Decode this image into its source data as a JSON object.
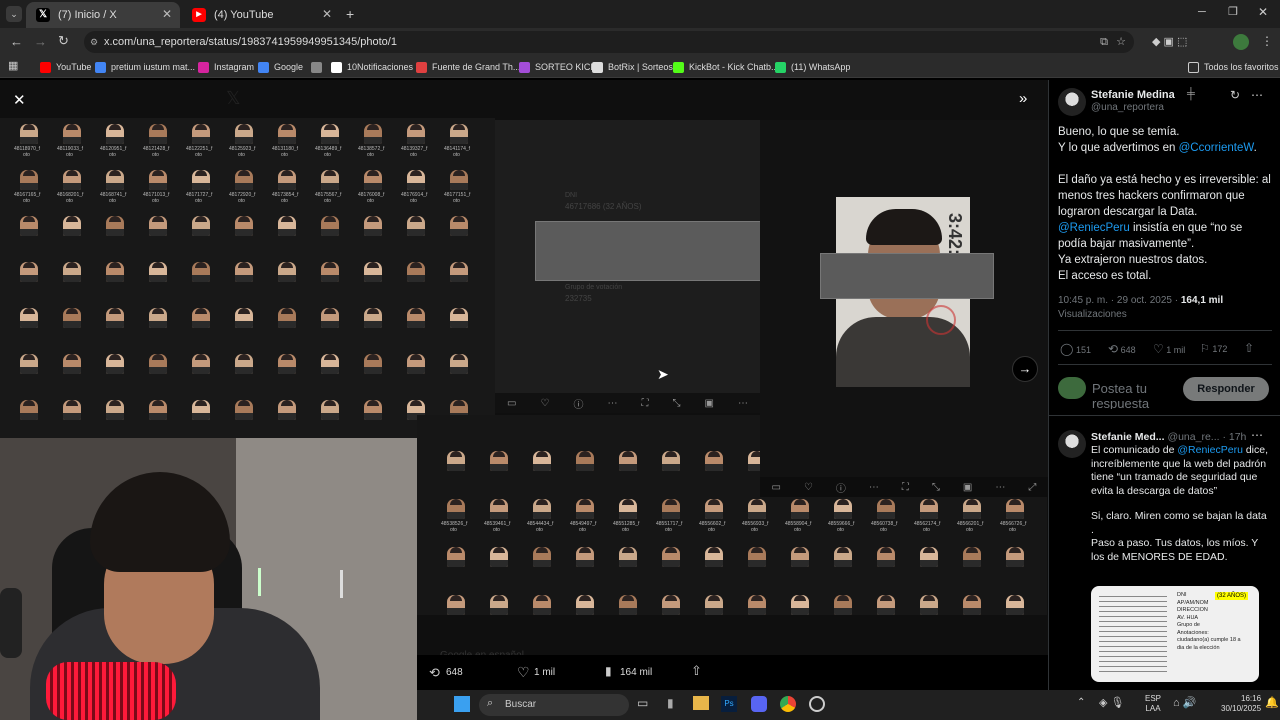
{
  "browser": {
    "tabs": [
      {
        "label": "(7) Inicio / X",
        "icon": "x-logo-icon"
      },
      {
        "label": "(4) YouTube",
        "icon": "youtube-icon"
      }
    ],
    "url": "x.com/una_reportera/status/1983741959949951345/photo/1",
    "bookmarks": [
      {
        "label": "YouTube",
        "color": "#ff0000"
      },
      {
        "label": "pretium iustum mat...",
        "color": "#4285f4"
      },
      {
        "label": "Instagram",
        "color": "#d6249f"
      },
      {
        "label": "Google",
        "color": "#4285f4"
      },
      {
        "label": "",
        "color": "#888888"
      },
      {
        "label": "10Notificaciones",
        "color": "#ffffff"
      },
      {
        "label": "Fuente de Grand Th...",
        "color": "#e04040"
      },
      {
        "label": "SORTEO KICK",
        "color": "#a34dd8"
      },
      {
        "label": "BotRix | Sorteos",
        "color": "#dddddd"
      },
      {
        "label": "KickBot - Kick Chatb...",
        "color": "#53fc18"
      },
      {
        "label": "(11) WhatsApp",
        "color": "#25d366"
      }
    ],
    "all_bookmarks": "Todos los favoritos"
  },
  "viewer": {
    "doc_snippets": {
      "dni_label": "DNI",
      "dni_value": "46717686 (32 AÑOS)",
      "group_label": "Grupo de votación",
      "group_value": "232735"
    },
    "stamp": "3:42:3",
    "sheet_caption": "oto",
    "ids_top": [
      "48118970_f",
      "48119033_f",
      "48120951_f",
      "48121428_f",
      "48122251_f",
      "48125923_f",
      "48131180_f",
      "48136489_f",
      "48138572_f",
      "48139327_f",
      "48141174_f"
    ],
    "ids_row2": [
      "48167165_f",
      "48168201_f",
      "48168741_f",
      "48171013_f",
      "48171727_f",
      "48172920_f",
      "48173854_f",
      "48175567_f",
      "48176008_f",
      "48176914_f",
      "48177151_f"
    ],
    "ids_bottom": [
      "48538526_f",
      "48539461_f",
      "48544434_f",
      "48549497_f",
      "48551285_f",
      "48551717_f",
      "48556602_f",
      "48556933_f",
      "48558904_f",
      "48559666_f",
      "48560738_f",
      "48562174_f",
      "48566201_f",
      "48566726_f"
    ],
    "stats": {
      "retweets": "648",
      "likes": "1 mil",
      "views": "164 mil"
    },
    "behind_text": "Google en español"
  },
  "post": {
    "author_name": "Stefanie Medina",
    "handle": "@una_reportera",
    "lines": [
      {
        "pre": "Bueno, lo que se temía.",
        "link": "",
        "post": ""
      },
      {
        "pre": "Y lo que advertimos en ",
        "link": "@CcorrienteW",
        "post": "."
      },
      {
        "pre": "",
        "link": "",
        "post": ""
      },
      {
        "pre": "El daño ya está hecho y es irreversible: al menos tres hackers confirmaron que lograron descargar la Data.",
        "link": "",
        "post": ""
      },
      {
        "pre": "",
        "link": "@ReniecPeru",
        "post": " insistía en que “no se podía bajar masivamente”."
      },
      {
        "pre": "Ya extrajeron nuestros datos.",
        "link": "",
        "post": ""
      },
      {
        "pre": "El acceso es total.",
        "link": "",
        "post": ""
      }
    ],
    "time": "10:45 p. m. · 29 oct. 2025",
    "views_count": "164,1 mil",
    "views_label": "Visualizaciones",
    "actions": {
      "replies": "151",
      "retweets": "648",
      "likes": "1 mil",
      "bookmarks": "172"
    },
    "reply_placeholder": "Postea tu respuesta",
    "reply_button": "Responder"
  },
  "reply": {
    "author_name": "Stefanie Med...",
    "handle": "@una_re...",
    "age": "· 17h",
    "text1_pre": "El comunicado de ",
    "text1_link": "@ReniecPeru",
    "text1_post": " dice, increíblemente que la web del padrón tiene “un tramado de seguridad que evita la descarga de datos”",
    "text2": "Si, claro. Miren como se bajan la data .",
    "text3": "Paso a paso. Tus datos, los míos. Y los de MENORES DE EDAD.",
    "thumb_badge": "(32 AÑOS)",
    "thumb_labels": [
      "DNI",
      "AP/AM/NOM",
      "DIRECCION",
      "AV. HUA",
      "Grupo de",
      "Anotaciones:",
      "ciudadano(a) cumple 18 a",
      "dia de la elección"
    ]
  },
  "taskbar": {
    "search_placeholder": "Buscar",
    "lang": "ESP",
    "lang2": "LAA",
    "time": "16:16",
    "date": "30/10/2025"
  },
  "colors": {
    "accent": "#1d9bf0",
    "bg": "#000000",
    "panel_border": "#2f3336"
  }
}
